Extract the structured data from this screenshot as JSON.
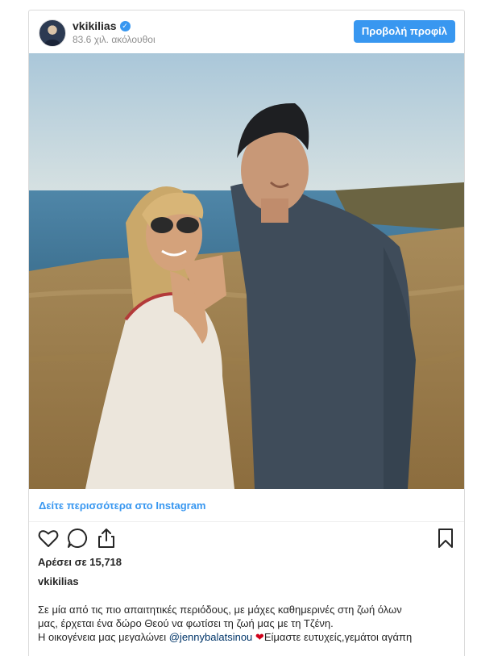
{
  "post": {
    "username": "vkikilias",
    "followers": "83.6 χιλ. ακόλουθοι",
    "profile_button": "Προβολή προφίλ",
    "see_more": "Δείτε περισσότερα στο Instagram",
    "likes": "Αρέσει σε 15,718",
    "caption_username": "vkikilias",
    "caption_line1": "Σε μία από τις πιο απαιτητικές περιόδους, με μάχες καθημερινές στη ζωή όλων",
    "caption_line2": "μας, έρχεται ένα δώρο Θεού να φωτίσει τη ζωή μας με τη Τζένη.",
    "caption_line3_pre": "Η οικογένεια μας μεγαλώνει ",
    "caption_mention": "@jennybalatsinou",
    "caption_emoji": "❤",
    "caption_line3_post": "Είμαστε ευτυχείς,γεμάτοι αγάπη"
  },
  "icons": {
    "verified": "verified-badge-icon",
    "like": "heart-icon",
    "comment": "comment-icon",
    "share": "share-icon",
    "save": "bookmark-icon"
  },
  "colors": {
    "accent": "#3897f0",
    "mention": "#003569",
    "emoji_heart": "#d0021b"
  }
}
